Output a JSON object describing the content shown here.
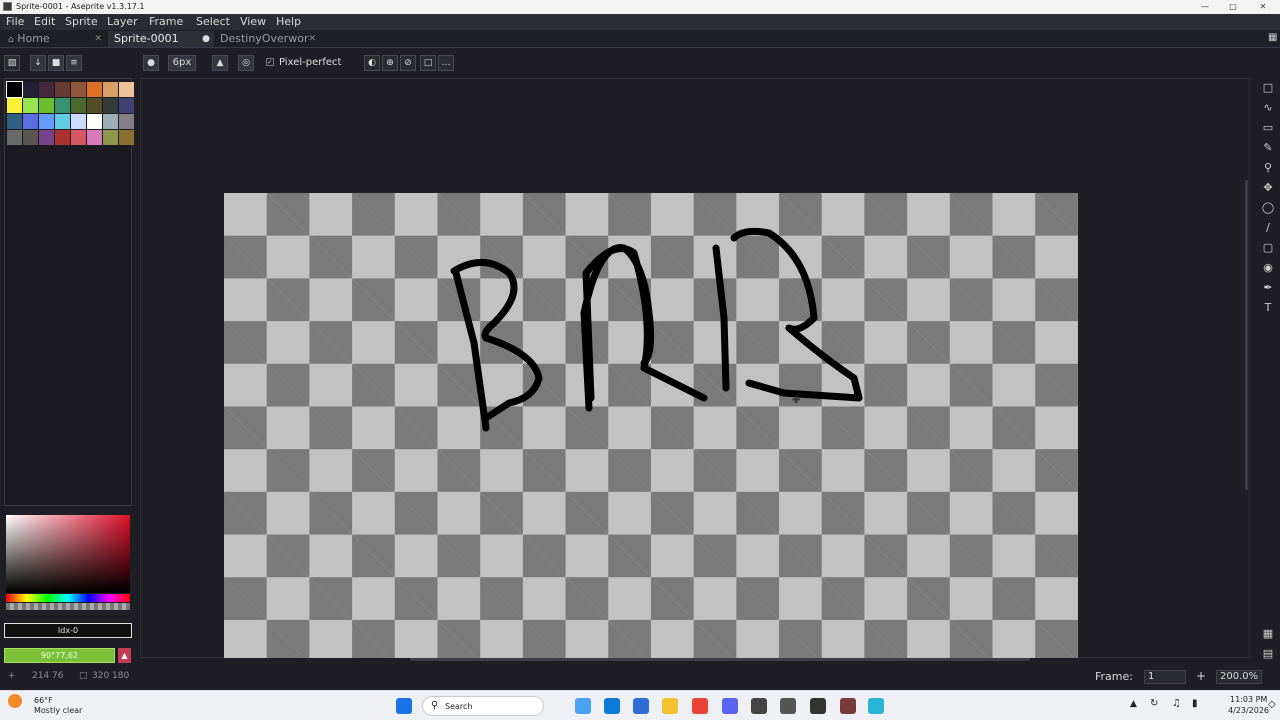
{
  "window": {
    "title": "Sprite-0001 - Aseprite v1.3.17.1"
  },
  "menu": [
    "File",
    "Edit",
    "Sprite",
    "Layer",
    "Frame",
    "Select",
    "View",
    "Help"
  ],
  "tabs": [
    {
      "label": "Home"
    },
    {
      "label": "Sprite-0001"
    },
    {
      "label": "DestinyOverwor"
    }
  ],
  "tool_options": {
    "brush_size": "6px",
    "pixel_perfect": "Pixel-perfect"
  },
  "palette": [
    "#000000",
    "#222034",
    "#45283c",
    "#663931",
    "#8f563b",
    "#df7126",
    "#d9a066",
    "#eec39a",
    "#fbf236",
    "#99e550",
    "#6abe30",
    "#37946e",
    "#4b692f",
    "#524b24",
    "#323c39",
    "#3f3f74",
    "#306082",
    "#5b6ee1",
    "#639bff",
    "#5fcde4",
    "#cbdbfc",
    "#ffffff",
    "#9badb7",
    "#847e87",
    "#696a6a",
    "#595652",
    "#76428a",
    "#ac3232",
    "#d95763",
    "#d77bba",
    "#8f974a",
    "#8a6f30"
  ],
  "color": {
    "index_label": "Idx-0",
    "hex_label": "90°77,62"
  },
  "statusbar": {
    "cursor_pos": "214  76",
    "sprite_size": "320  180",
    "frame_label": "Frame:",
    "frame_value": "1",
    "zoom": "200.0%"
  },
  "taskbar": {
    "weather_temp": "66°F",
    "weather_desc": "Mostly clear",
    "search_label": "Search",
    "time": "11:03 PM",
    "date": "4/23/2026"
  },
  "drawing_text": "BRB"
}
